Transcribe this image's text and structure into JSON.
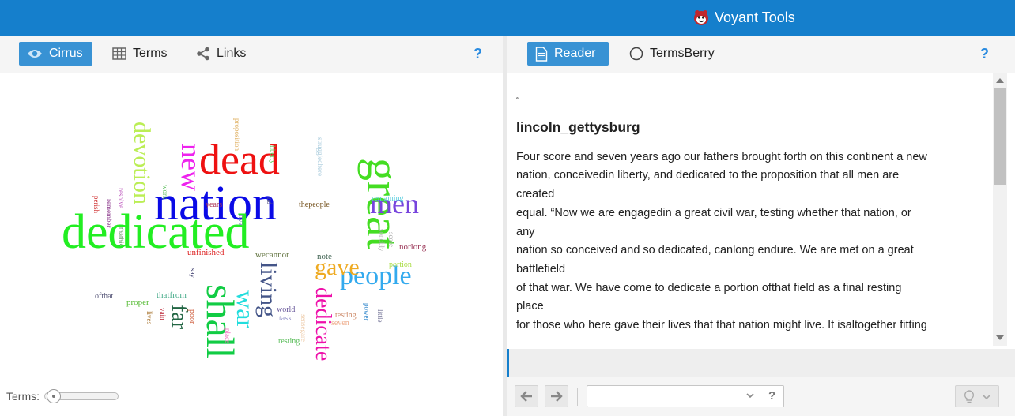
{
  "app": {
    "title": "Voyant Tools"
  },
  "left_panel": {
    "tabs": [
      {
        "label": "Cirrus",
        "active": true,
        "icon": "eye-icon"
      },
      {
        "label": "Terms",
        "active": false,
        "icon": "table-icon"
      },
      {
        "label": "Links",
        "active": false,
        "icon": "share-icon"
      }
    ],
    "help": "?",
    "terms_label": "Terms:",
    "terms_slider_fraction": 0.03
  },
  "right_panel": {
    "tabs": [
      {
        "label": "Reader",
        "active": true,
        "icon": "document-icon"
      },
      {
        "label": "TermsBerry",
        "active": false,
        "icon": "circle-icon"
      }
    ],
    "help": "?",
    "reader": {
      "quote_mark": "“",
      "doc_title": "lincoln_gettysburg",
      "lines": [
        "Four score and seven years ago our fathers brought forth on this continent a new",
        "nation, conceivedin liberty, and dedicated to the proposition that all men are",
        "created",
        "equal. “Now we are engagedin a great civil war, testing whether that nation, or",
        "any",
        "nation so conceived and so dedicated, canlong endure. We are met on a great",
        "battlefield",
        "of that war. We have come to dedicate a portion ofthat field as a final resting",
        "place",
        "for those who here gave their lives that that nation might live. It isaltogether fitting"
      ]
    },
    "search": {
      "value": "",
      "help": "?"
    }
  },
  "colors": {
    "topbar": "#157fcc",
    "active_tab": "#3892d4",
    "help": "#2a8be0"
  },
  "word_cloud": [
    {
      "word": "nation",
      "color": "#0a0ae6"
    },
    {
      "word": "dedicated",
      "color": "#22ee22"
    },
    {
      "word": "dead",
      "color": "#ee1111"
    },
    {
      "word": "great",
      "color": "#44dd22"
    },
    {
      "word": "shall",
      "color": "#11cc44"
    },
    {
      "word": "new",
      "color": "#ee22ee"
    },
    {
      "word": "devotion",
      "color": "#bbee55"
    },
    {
      "word": "men",
      "color": "#7744dd"
    },
    {
      "word": "people",
      "color": "#33aaee"
    },
    {
      "word": "gave",
      "color": "#eeaa22"
    },
    {
      "word": "living",
      "color": "#445588"
    },
    {
      "word": "war",
      "color": "#22dddd"
    },
    {
      "word": "dedicate",
      "color": "#ee11aa"
    },
    {
      "word": "far",
      "color": "#226644"
    },
    {
      "word": "proposition",
      "color": "#ddaa55"
    },
    {
      "word": "liberty",
      "color": "#55cc55"
    },
    {
      "word": "struggledhere",
      "color": "#aaccdd"
    },
    {
      "word": "remaining",
      "color": "#55ccdd"
    },
    {
      "word": "norlong",
      "color": "#993355"
    },
    {
      "word": "score",
      "color": "#aaaaaa"
    },
    {
      "word": "sonobly",
      "color": "#aaaaaa"
    },
    {
      "word": "portion",
      "color": "#aadd44"
    },
    {
      "word": "note",
      "color": "#446655"
    },
    {
      "word": "wecannot",
      "color": "#667744"
    },
    {
      "word": "unfinished",
      "color": "#dd2222"
    },
    {
      "word": "thepeople",
      "color": "#775522"
    },
    {
      "word": "years",
      "color": "#aa3355"
    },
    {
      "word": "nd",
      "color": "#555588"
    },
    {
      "word": "live",
      "color": "#7777bb"
    },
    {
      "word": "work",
      "color": "#55bb55"
    },
    {
      "word": "resolve",
      "color": "#bb55bb"
    },
    {
      "word": "remember",
      "color": "#883388"
    },
    {
      "word": "thathis",
      "color": "#558855"
    },
    {
      "word": "perish",
      "color": "#cc2222"
    },
    {
      "word": "say",
      "color": "#333366"
    },
    {
      "word": "ofthat",
      "color": "#555577"
    },
    {
      "word": "proper",
      "color": "#55bb33"
    },
    {
      "word": "thatfrom",
      "color": "#44aa88"
    },
    {
      "word": "lives",
      "color": "#aa7733"
    },
    {
      "word": "vain",
      "color": "#bb2233"
    },
    {
      "word": "poor",
      "color": "#cc5533"
    },
    {
      "word": "place",
      "color": "#ee66bb"
    },
    {
      "word": "world",
      "color": "#665599"
    },
    {
      "word": "task",
      "color": "#9999cc"
    },
    {
      "word": "sensegare",
      "color": "#eeccaa"
    },
    {
      "word": "resting",
      "color": "#55bb55"
    },
    {
      "word": "testing",
      "color": "#cc8866"
    },
    {
      "word": "seven",
      "color": "#eeaa88"
    },
    {
      "word": "power",
      "color": "#3388cc"
    },
    {
      "word": "little",
      "color": "#777799"
    }
  ]
}
